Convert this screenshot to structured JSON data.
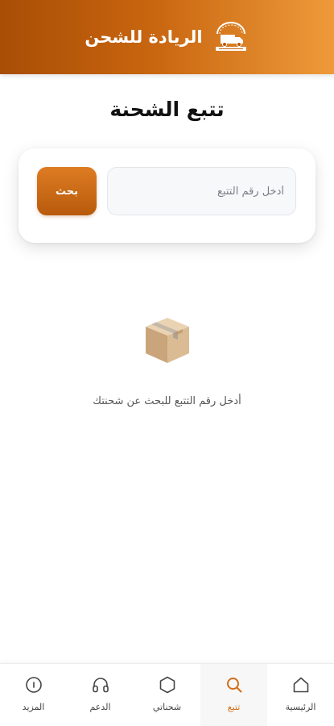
{
  "header": {
    "title": "الريادة للشحن",
    "logo_icon": "truck-logo-icon"
  },
  "page": {
    "title": "تتبع الشحنة"
  },
  "search": {
    "placeholder": "أدخل رقم التتبع",
    "value": "",
    "button_label": "بحث"
  },
  "empty_state": {
    "icon": "box-icon",
    "message": "أدخل رقم التتبع للبحث عن شحنتك"
  },
  "bottom_nav": {
    "items": [
      {
        "label": "الرئيسية",
        "icon": "home-icon",
        "active": false
      },
      {
        "label": "تتبع",
        "icon": "search-icon",
        "active": true
      },
      {
        "label": "شحناتي",
        "icon": "hexagon-icon",
        "active": false
      },
      {
        "label": "الدعم",
        "icon": "headphones-icon",
        "active": false
      },
      {
        "label": "المزيد",
        "icon": "more-icon",
        "active": false
      }
    ]
  },
  "colors": {
    "brand": "#c8650f",
    "brand_light": "#ee9a3a",
    "brand_dark": "#a84e06",
    "active_nav": "#d26d16"
  }
}
